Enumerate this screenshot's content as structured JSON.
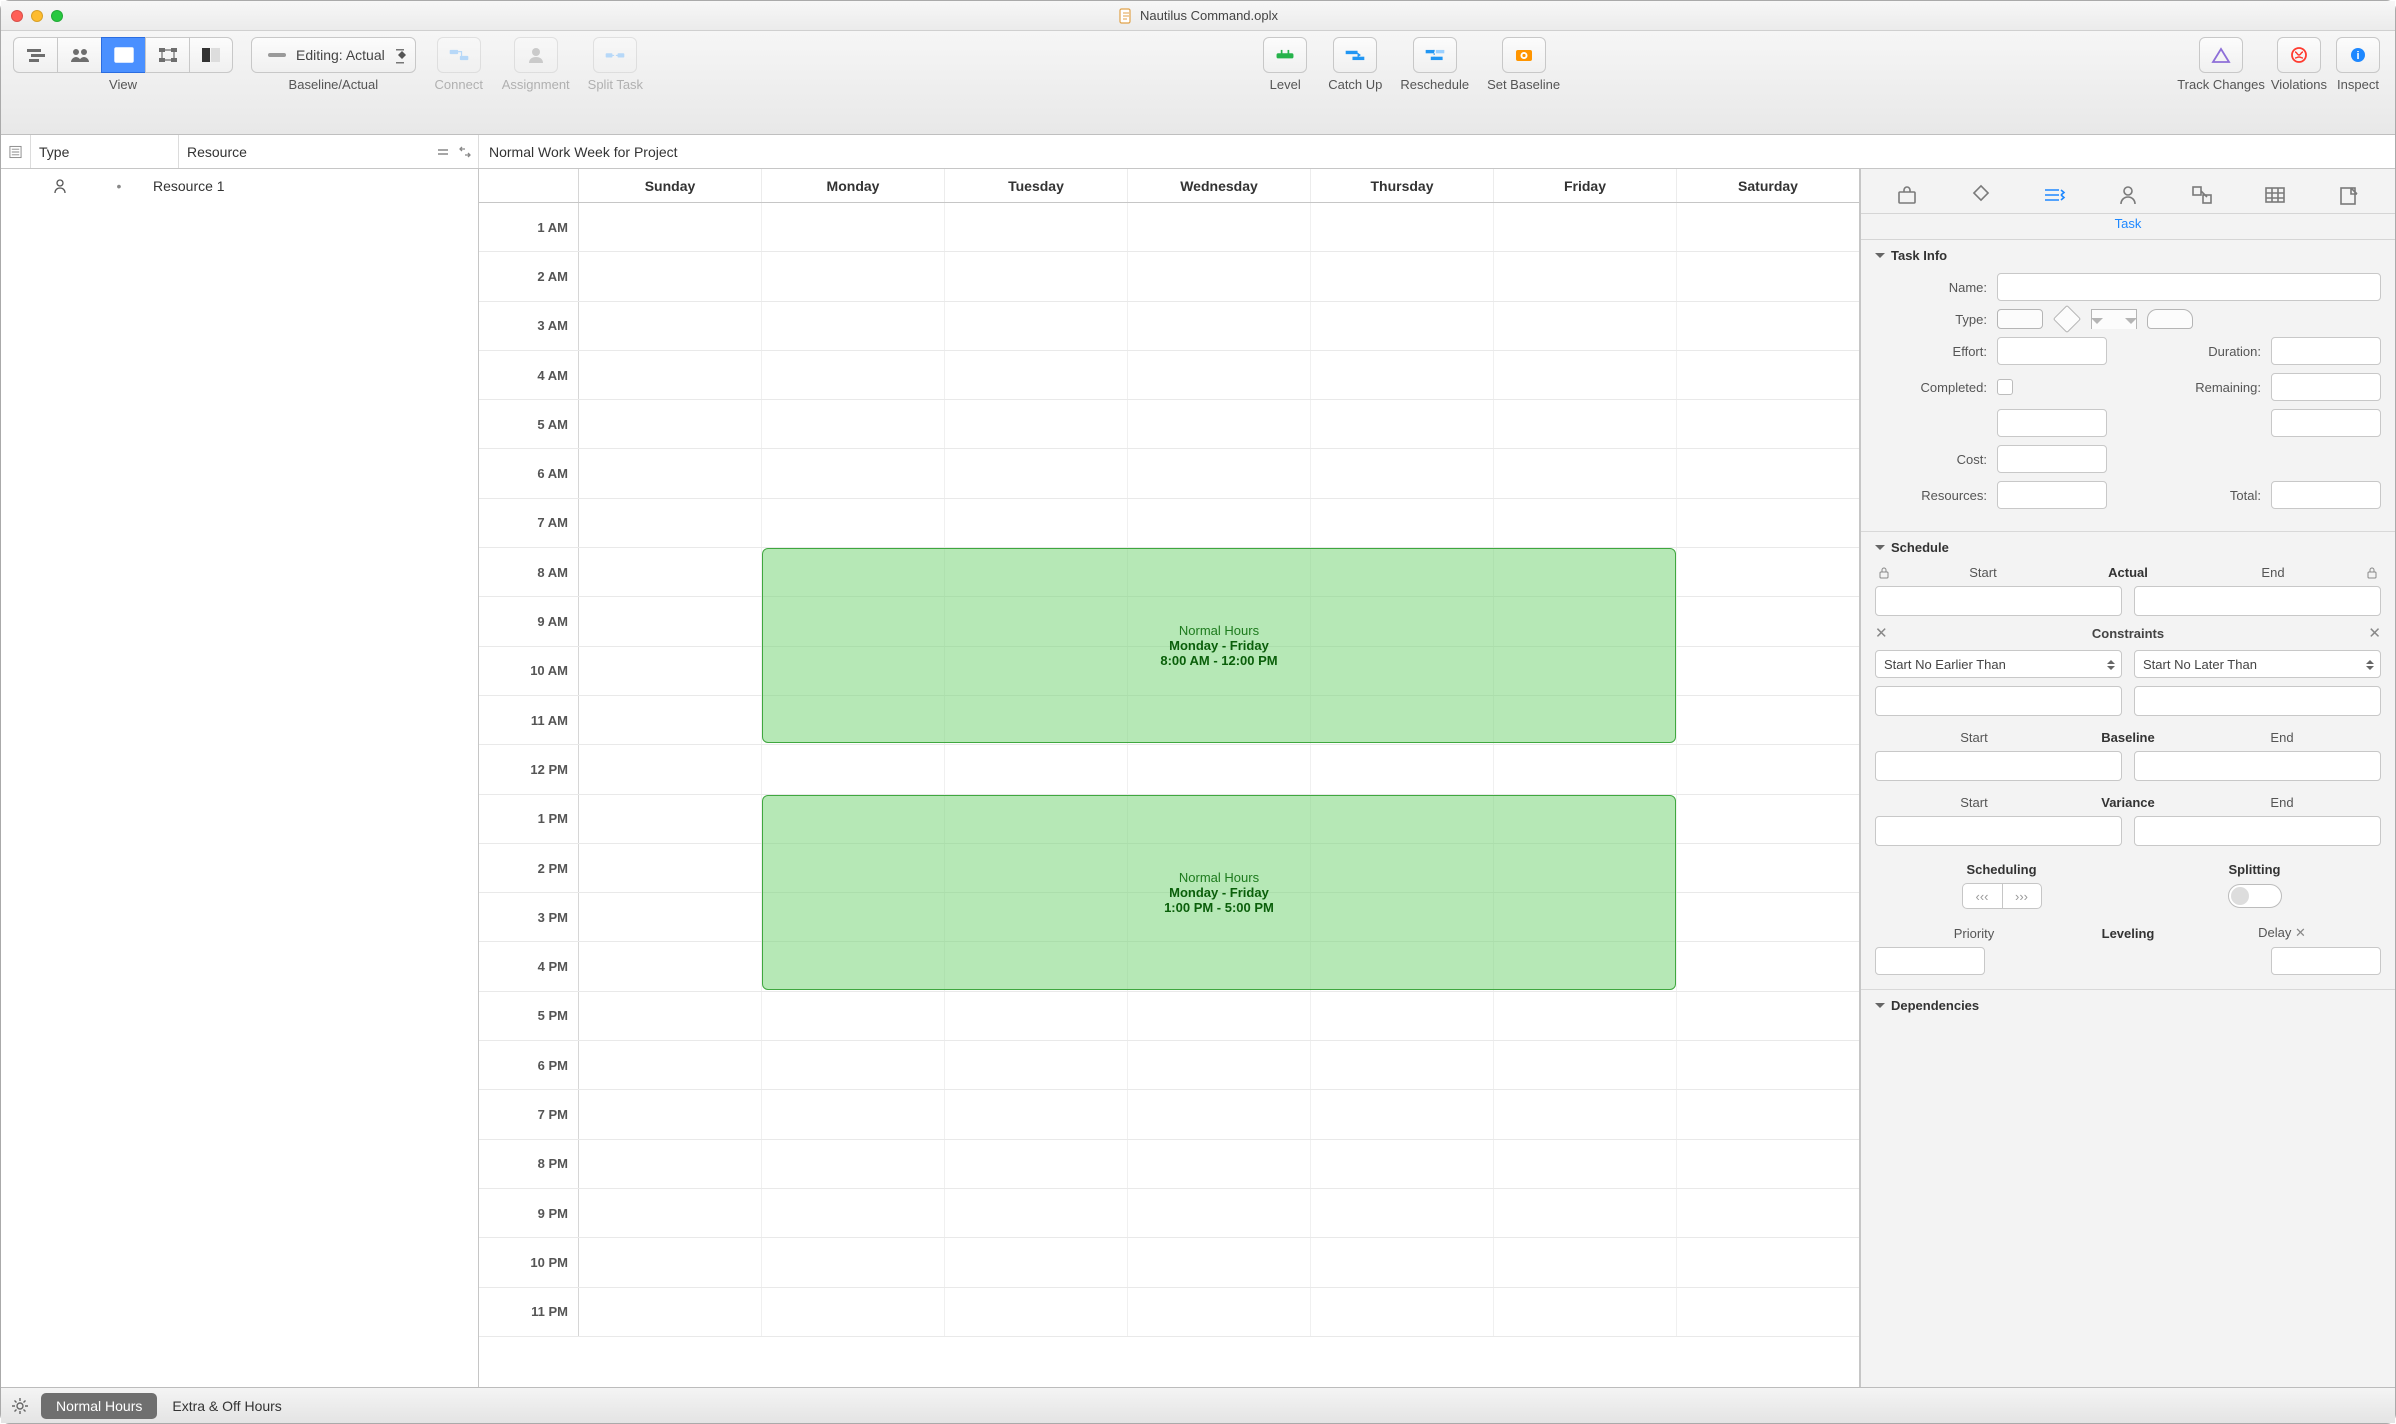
{
  "window": {
    "title": "Nautilus Command.oplx"
  },
  "toolbar": {
    "view_label": "View",
    "baseline_label": "Baseline/Actual",
    "editing_popup": "Editing: Actual",
    "connect": "Connect",
    "assignment": "Assignment",
    "split_task": "Split Task",
    "level": "Level",
    "catch_up": "Catch Up",
    "reschedule": "Reschedule",
    "set_baseline": "Set Baseline",
    "track_changes": "Track Changes",
    "violations": "Violations",
    "inspect": "Inspect"
  },
  "left_headers": {
    "type": "Type",
    "resource": "Resource"
  },
  "resources": [
    {
      "name": "Resource 1"
    }
  ],
  "calendar": {
    "title": "Normal Work Week for Project",
    "days": [
      "Sunday",
      "Monday",
      "Tuesday",
      "Wednesday",
      "Thursday",
      "Friday",
      "Saturday"
    ],
    "hours": [
      "1 AM",
      "2 AM",
      "3 AM",
      "4 AM",
      "5 AM",
      "6 AM",
      "7 AM",
      "8 AM",
      "9 AM",
      "10 AM",
      "11 AM",
      "12 PM",
      "1 PM",
      "2 PM",
      "3 PM",
      "4 PM",
      "5 PM",
      "6 PM",
      "7 PM",
      "8 PM",
      "9 PM",
      "10 PM",
      "11 PM"
    ],
    "events": [
      {
        "title": "Normal Hours",
        "subtitle": "Monday - Friday",
        "time": "8:00 AM - 12:00 PM"
      },
      {
        "title": "Normal Hours",
        "subtitle": "Monday - Friday",
        "time": "1:00 PM - 5:00 PM"
      }
    ]
  },
  "footer": {
    "tab1": "Normal Hours",
    "tab2": "Extra & Off Hours"
  },
  "inspector": {
    "active_tab": "Task",
    "sections": {
      "task_info": "Task Info",
      "schedule": "Schedule",
      "dependencies": "Dependencies"
    },
    "labels": {
      "name": "Name:",
      "type": "Type:",
      "effort": "Effort:",
      "duration": "Duration:",
      "completed": "Completed:",
      "remaining": "Remaining:",
      "cost": "Cost:",
      "resources": "Resources:",
      "total": "Total:",
      "start": "Start",
      "end": "End",
      "actual": "Actual",
      "constraints": "Constraints",
      "constraint_earlier": "Start No Earlier Than",
      "constraint_later": "Start No Later Than",
      "baseline": "Baseline",
      "variance": "Variance",
      "scheduling": "Scheduling",
      "splitting": "Splitting",
      "priority": "Priority",
      "leveling": "Leveling",
      "delay": "Delay"
    }
  }
}
